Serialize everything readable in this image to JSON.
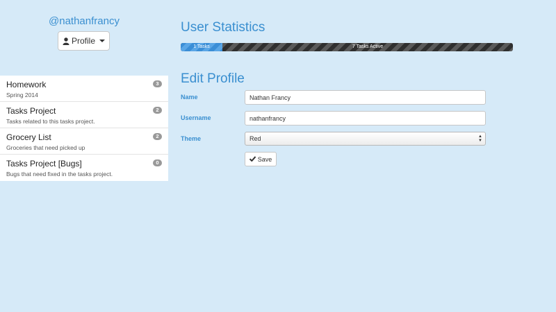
{
  "sidebar": {
    "username": "@nathanfrancy",
    "profile_button": "Profile",
    "items": [
      {
        "title": "Homework",
        "subtitle": "Spring 2014",
        "count": "3"
      },
      {
        "title": "Tasks Project",
        "subtitle": "Tasks related to this tasks project.",
        "count": "2"
      },
      {
        "title": "Grocery List",
        "subtitle": "Groceries that need picked up",
        "count": "2"
      },
      {
        "title": "Tasks Project [Bugs]",
        "subtitle": "Bugs that need fixed in the tasks project.",
        "count": "0"
      }
    ]
  },
  "stats": {
    "heading": "User Statistics",
    "done_label": "1 Tasks",
    "active_label": "7 Tasks Active"
  },
  "edit": {
    "heading": "Edit Profile",
    "name_label": "Name",
    "name_value": "Nathan Francy",
    "username_label": "Username",
    "username_value": "nathanfrancy",
    "theme_label": "Theme",
    "theme_value": "Red",
    "save_label": "Save"
  },
  "colors": {
    "background": "#d6eaf8",
    "accent": "#3a8fd0",
    "badge": "#999999"
  },
  "icons": {
    "profile": "user-icon",
    "dropdown": "caret-down-icon",
    "save": "checkmark-icon",
    "select": "select-arrows-icon"
  }
}
